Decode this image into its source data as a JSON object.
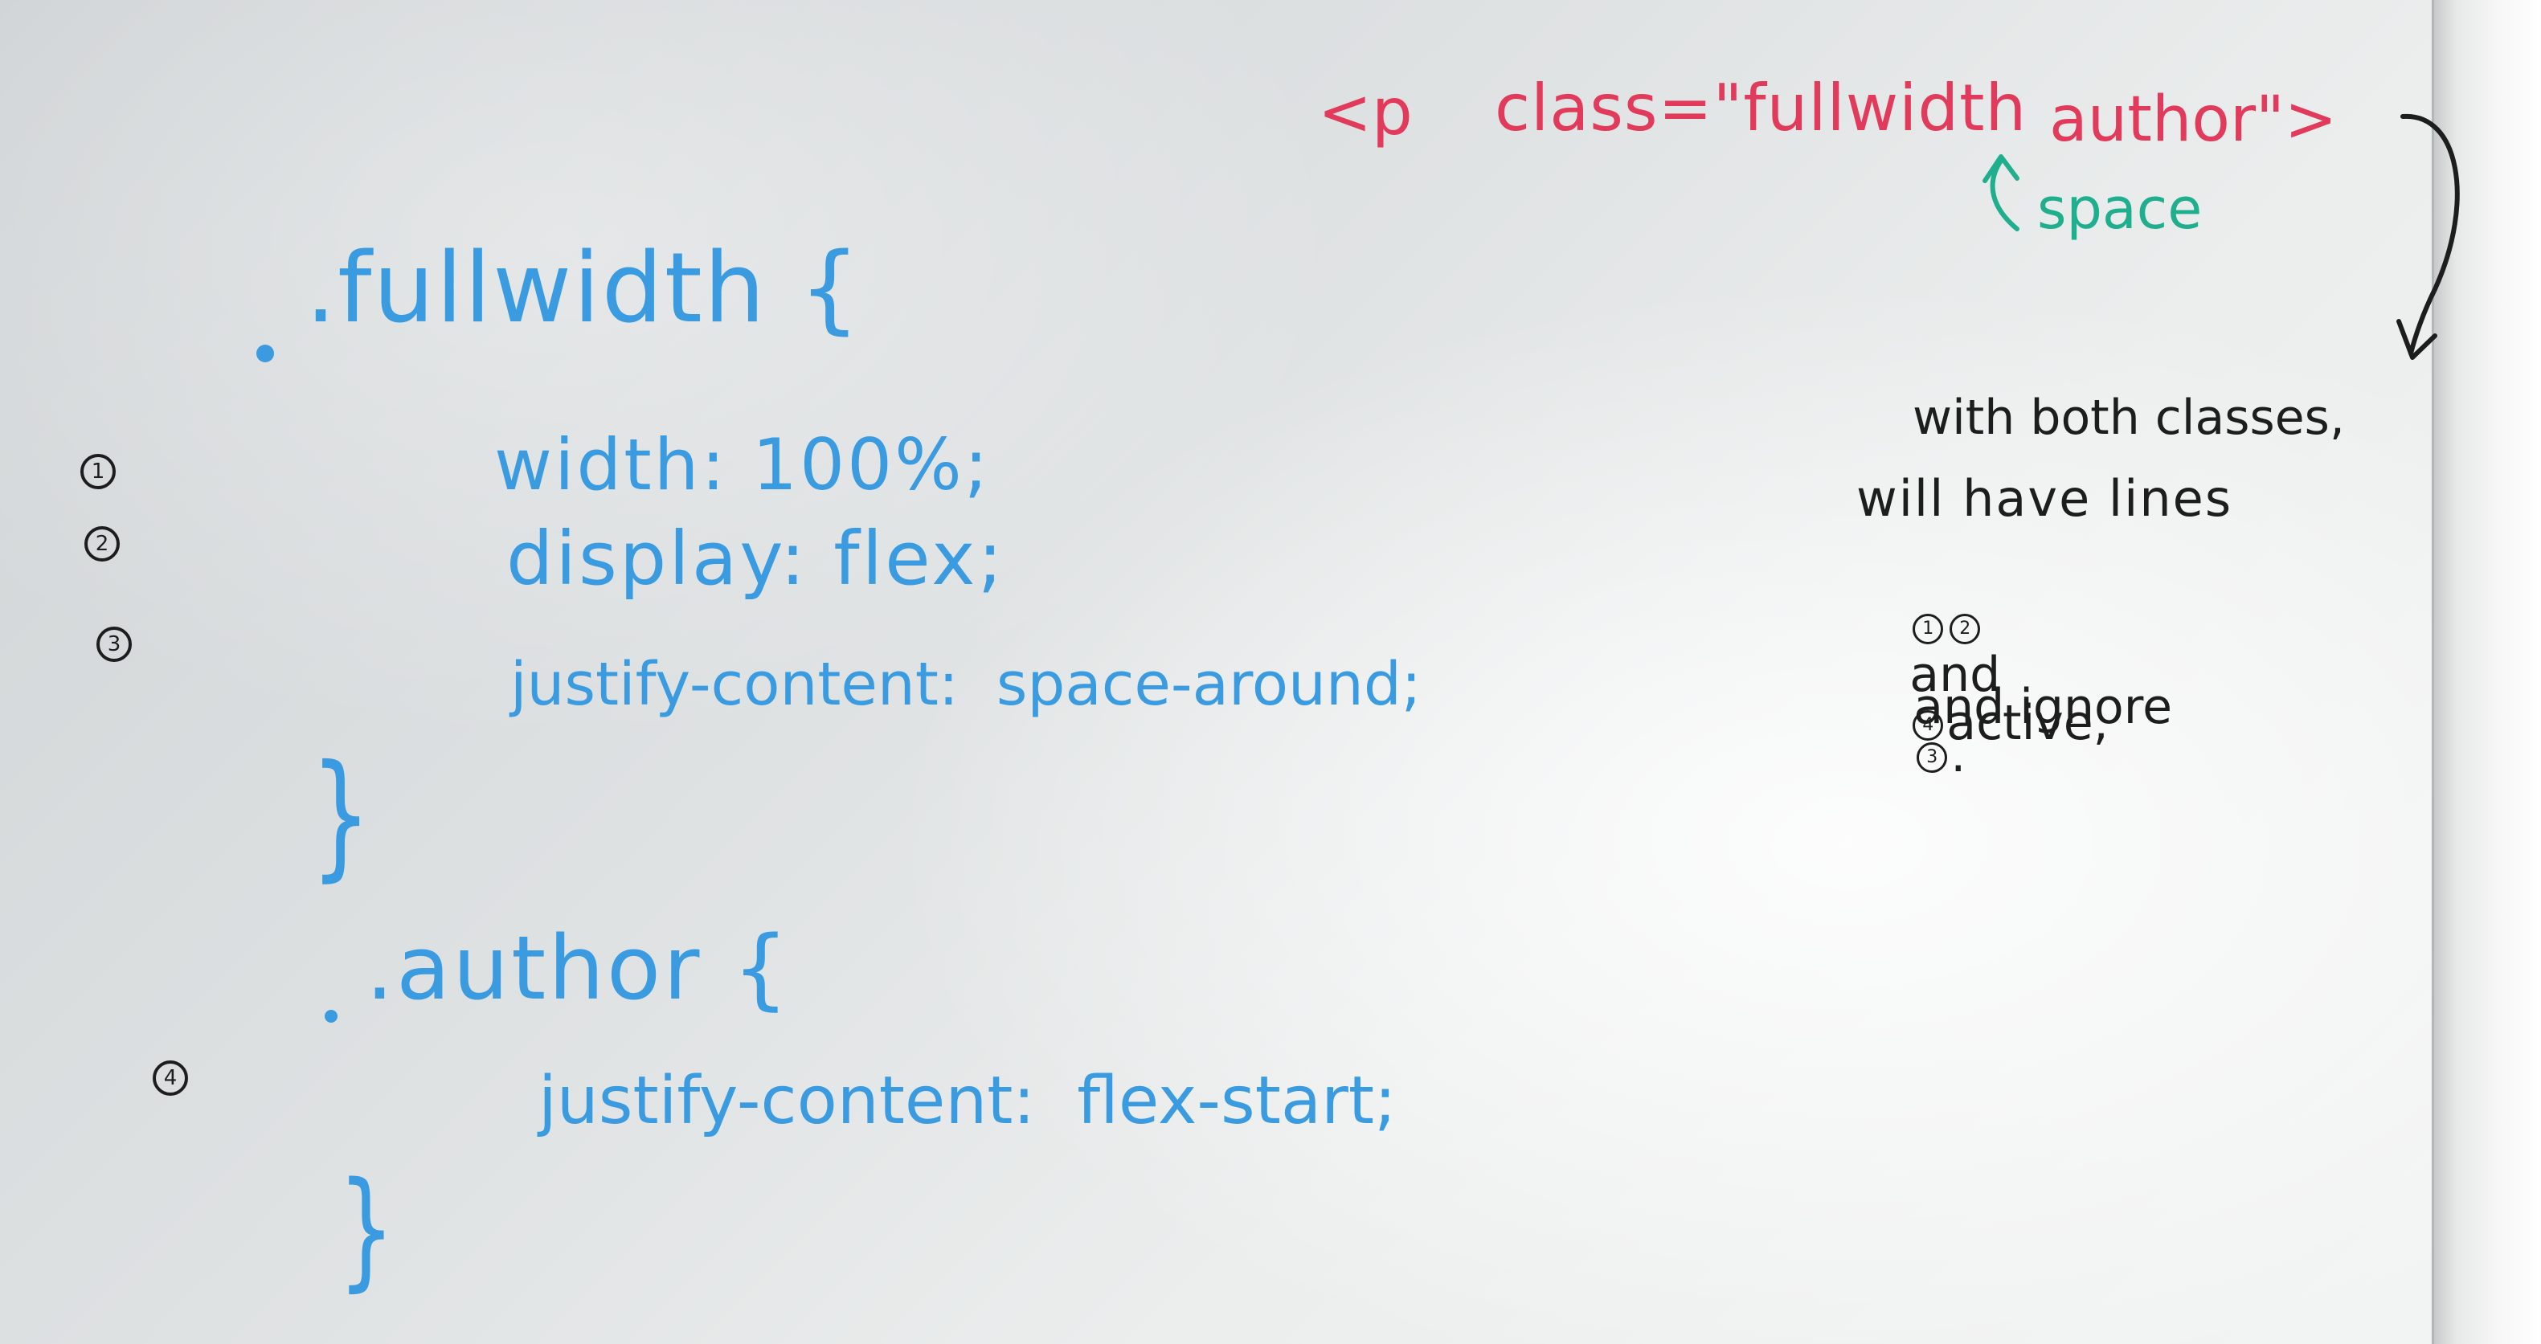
{
  "board": {
    "markup": {
      "open_tag": "<p",
      "attr": "class=\"fullwidth",
      "attr2": "author\">",
      "space_note": "space"
    },
    "css_blocks": [
      {
        "selector": ".fullwidth {",
        "lines": [
          {
            "marker": "1",
            "text": "width: 100%;"
          },
          {
            "marker": "2",
            "text": "display: flex;"
          },
          {
            "marker": "3",
            "text": "justify-content:  space-around;"
          }
        ],
        "close": "}"
      },
      {
        "selector": ".author {",
        "lines": [
          {
            "marker": "4",
            "text": "justify-content:  flex-start;"
          }
        ],
        "close": "}"
      }
    ],
    "note": {
      "line1": "with both classes,",
      "line2": "will have lines",
      "line3_markers": [
        "1",
        "2"
      ],
      "line3_and": "and",
      "line3_marker3": "4",
      "line3_tail": "active,",
      "line4_head": "and ignore",
      "line4_marker": "3",
      "line4_tail": "."
    }
  },
  "colors": {
    "blue_marker": "#3a9be0",
    "red_marker": "#e23a5a",
    "teal_marker": "#1fae8e",
    "black_marker": "#1d1d1d"
  }
}
